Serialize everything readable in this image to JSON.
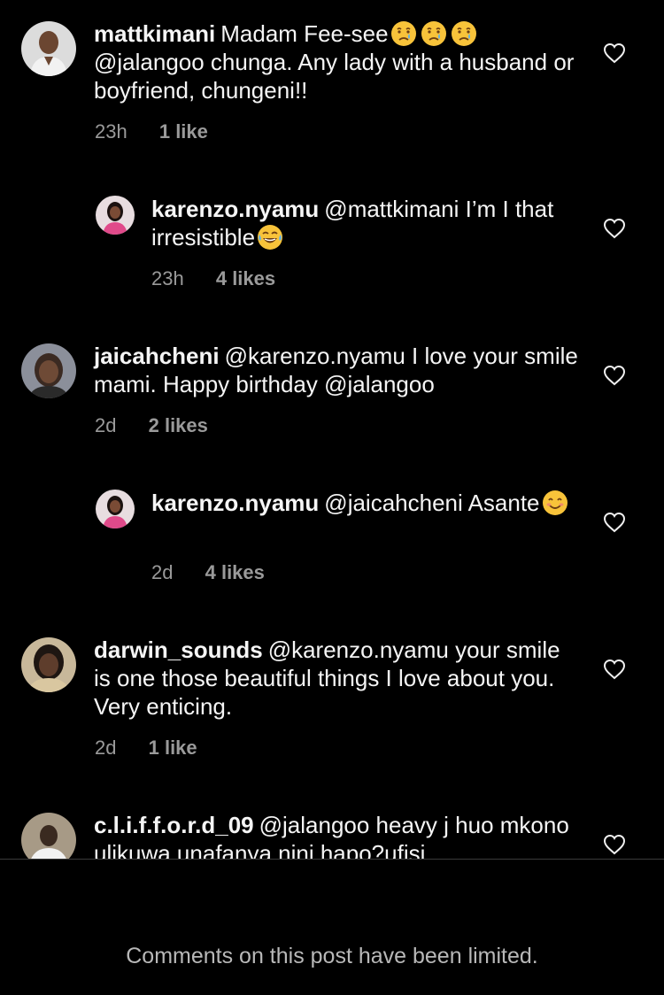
{
  "comments": [
    {
      "username": "mattkimani",
      "text_before_emoji": "Madam Fee-see",
      "text_after_emoji": "@jalangoo  chunga. Any lady with a husband or boyfriend, chungeni!!",
      "emoji": "crying-face-emoji",
      "time": "23h",
      "likes": "1 like"
    },
    {
      "username": "karenzo.nyamu",
      "text": "@mattkimani I’m I that irresistible",
      "emoji": "tears-of-joy-emoji",
      "time": "23h",
      "likes": "4 likes"
    },
    {
      "username": "jaicahcheni",
      "text": "@karenzo.nyamu I love your smile mami. Happy birthday @jalangoo",
      "time": "2d",
      "likes": "2 likes"
    },
    {
      "username": "karenzo.nyamu",
      "text": "@jaicahcheni Asante",
      "emoji": "smiling-face-emoji",
      "time": "2d",
      "likes": "4 likes"
    },
    {
      "username": "darwin_sounds",
      "text": "@karenzo.nyamu your smile is one those beautiful things I love about you. Very enticing.",
      "time": "2d",
      "likes": "1 like"
    },
    {
      "username": "c.l.i.f.f.o.r.d_09",
      "text": "@jalangoo heavy j huo mkono ulikuwa unafanya nini hapo?ufisi"
    }
  ],
  "footer": {
    "notice": "Comments on this post have been limited."
  },
  "colors": {
    "background": "#000000",
    "text": "#f5f5f5",
    "meta": "#9a9a9a",
    "notice": "#b8b8b8"
  }
}
